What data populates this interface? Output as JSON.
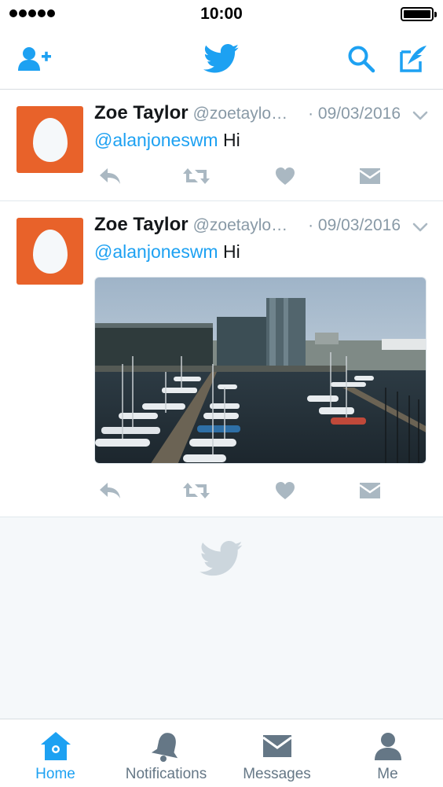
{
  "status_bar": {
    "time": "10:00"
  },
  "nav": {
    "add_user_icon": "add-user-icon",
    "logo_icon": "twitter-bird-icon",
    "search_icon": "search-icon",
    "compose_icon": "compose-icon"
  },
  "tweets": [
    {
      "display_name": "Zoe Taylor",
      "handle": "@zoetaylo…",
      "date": "· 09/03/2016",
      "mention": "@alanjoneswm",
      "text": "Hi",
      "has_media": false
    },
    {
      "display_name": "Zoe Taylor",
      "handle": "@zoetaylo…",
      "date": "· 09/03/2016",
      "mention": "@alanjoneswm",
      "text": "Hi",
      "has_media": true
    }
  ],
  "tab_bar": {
    "tabs": [
      {
        "label": "Home",
        "icon": "home-icon",
        "active": true
      },
      {
        "label": "Notifications",
        "icon": "bell-icon",
        "active": false
      },
      {
        "label": "Messages",
        "icon": "envelope-icon",
        "active": false
      },
      {
        "label": "Me",
        "icon": "person-icon",
        "active": false
      }
    ]
  },
  "colors": {
    "accent": "#1da1f2",
    "avatar_bg": "#e8622a",
    "muted": "#8899a6",
    "action_gray": "#aab8c2",
    "empty_bg": "#f5f8fa"
  }
}
